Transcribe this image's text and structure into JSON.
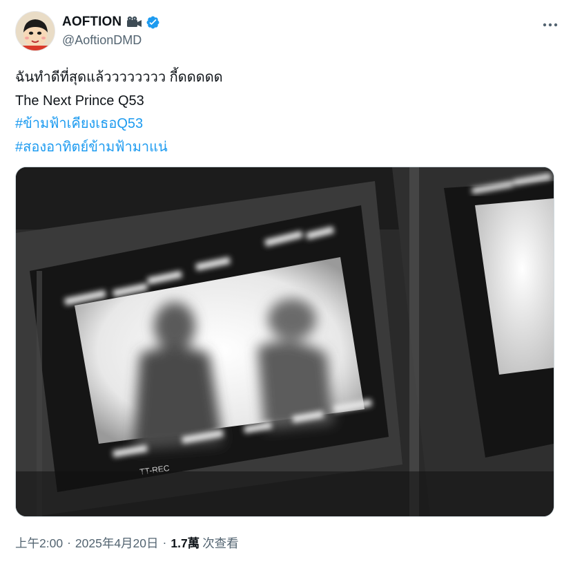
{
  "author": {
    "display_name": "AOFTION",
    "emoji_icon": "movie-camera-icon",
    "verified_icon": "verified-badge-icon",
    "verified_color": "#1d9bf0",
    "handle": "@AoftionDMD"
  },
  "tweet": {
    "lines": [
      "ฉันทำดีที่สุดแล้วววววววว กี้ดดดดด",
      "The Next Prince Q53"
    ],
    "hashtags": [
      "#ข้ามฟ้าเคียงเธอQ53",
      "#สองอาทิตย์ข้ามฟ้ามาแน่"
    ],
    "hashtag_color": "#1d9bf0"
  },
  "media": {
    "monitor_brand": "TT-REC"
  },
  "meta": {
    "time": "上午2:00",
    "separator": "·",
    "date": "2025年4月20日",
    "views_count": "1.7萬",
    "views_label": "次查看"
  },
  "icons": {
    "more": "more-options-icon"
  }
}
